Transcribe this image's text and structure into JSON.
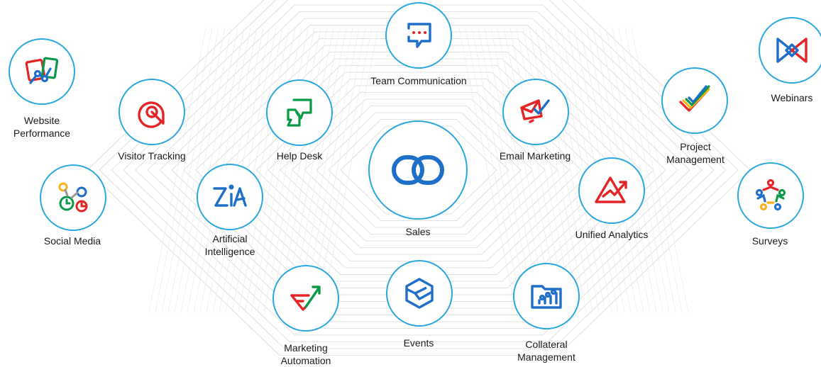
{
  "colors": {
    "circle_border": "#2aa7df",
    "lines": "#d9d9d9",
    "blue": "#1f6fc9",
    "red": "#e42527",
    "green": "#089949",
    "yellow": "#f9b21d"
  },
  "center": {
    "label": "Sales",
    "icon": "zoho-crm-infinity-icon"
  },
  "apps": [
    {
      "key": "website",
      "label": "Website\nPerformance",
      "icon": "website-performance-icon"
    },
    {
      "key": "visitor",
      "label": "Visitor Tracking",
      "icon": "visitor-tracking-icon"
    },
    {
      "key": "social",
      "label": "Social Media",
      "icon": "social-media-icon"
    },
    {
      "key": "helpdesk",
      "label": "Help Desk",
      "icon": "help-desk-icon"
    },
    {
      "key": "ai",
      "label": "Artificial\nIntelligence",
      "icon": "artificial-intelligence-icon"
    },
    {
      "key": "marketing",
      "label": "Marketing\nAutomation",
      "icon": "marketing-automation-icon"
    },
    {
      "key": "team",
      "label": "Team Communication",
      "icon": "team-communication-icon"
    },
    {
      "key": "events",
      "label": "Events",
      "icon": "events-icon"
    },
    {
      "key": "email",
      "label": "Email Marketing",
      "icon": "email-marketing-icon"
    },
    {
      "key": "analytics",
      "label": "Unified Analytics",
      "icon": "unified-analytics-icon"
    },
    {
      "key": "collateral",
      "label": "Collateral\nManagement",
      "icon": "collateral-management-icon"
    },
    {
      "key": "project",
      "label": "Project\nManagement",
      "icon": "project-management-icon"
    },
    {
      "key": "webinars",
      "label": "Webinars",
      "icon": "webinars-icon"
    },
    {
      "key": "surveys",
      "label": "Surveys",
      "icon": "surveys-icon"
    }
  ]
}
